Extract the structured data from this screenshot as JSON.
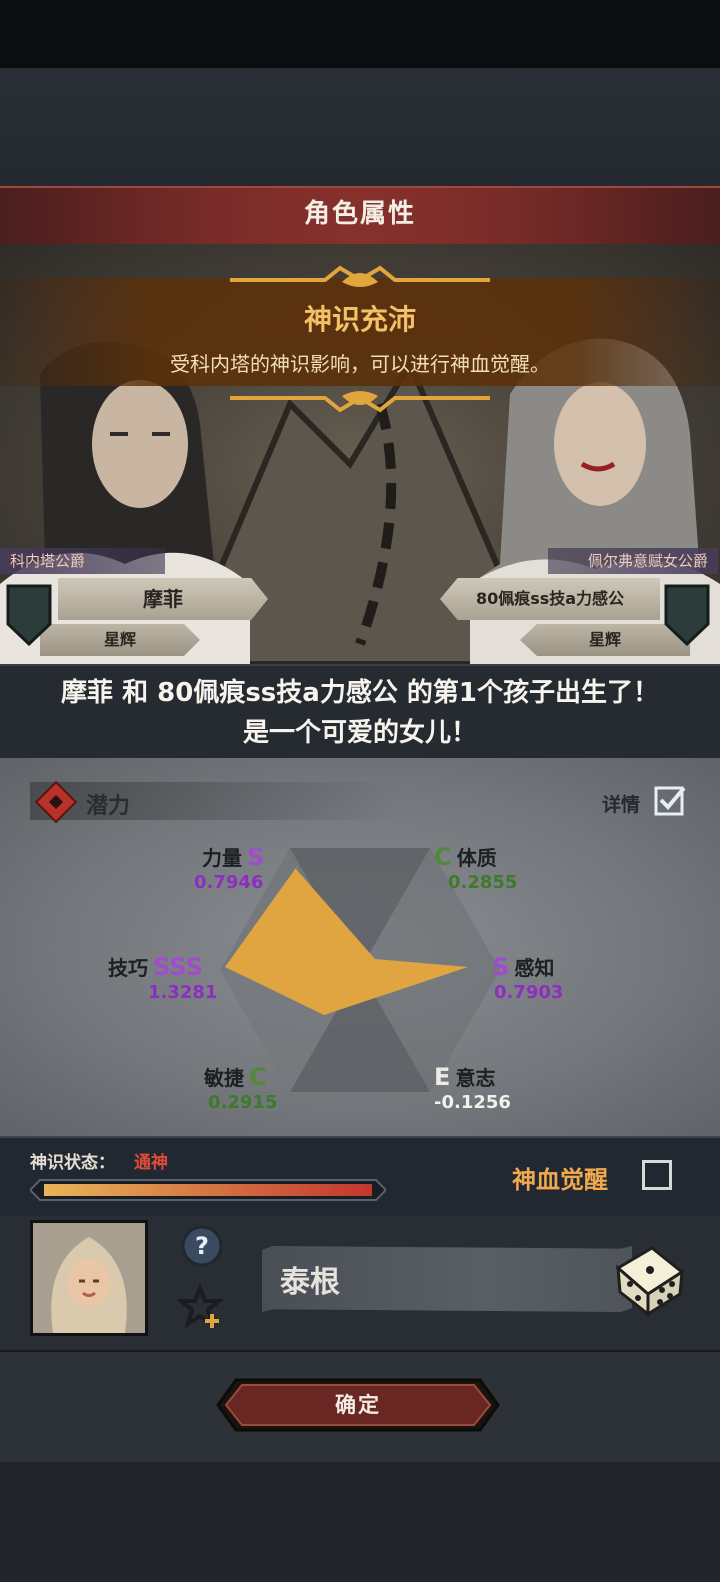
{
  "header": {
    "title": "角色属性"
  },
  "announcement": {
    "title": "神识充沛",
    "description": "受科内塔的神识影响，可以进行神血觉醒。"
  },
  "parents": {
    "father": {
      "title": "科内塔公爵",
      "name": "摩菲",
      "sub": "星辉"
    },
    "mother": {
      "title": "佩尔弗意赋女公爵",
      "name": "80佩痕ss技a力感公",
      "sub": "星辉"
    }
  },
  "birth_message": {
    "line1": "摩菲 和 80佩痕ss技a力感公 的第1个孩子出生了！",
    "line2": "是一个可爱的女儿！"
  },
  "potential": {
    "label": "潜力",
    "detail_label": "详情",
    "detail_checked": true,
    "stats": {
      "strength": {
        "name": "力量",
        "grade": "S",
        "value": "0.7946"
      },
      "constitution": {
        "name": "体质",
        "grade": "C",
        "value": "0.2855"
      },
      "skill": {
        "name": "技巧",
        "grade": "SSS",
        "value": "1.3281"
      },
      "perception": {
        "name": "感知",
        "grade": "S",
        "value": "0.7903"
      },
      "agility": {
        "name": "敏捷",
        "grade": "C",
        "value": "0.2915"
      },
      "will": {
        "name": "意志",
        "grade": "E",
        "value": "-0.1256"
      }
    },
    "radar_color": "#e0a540"
  },
  "bloodline": {
    "state_label": "神识状态：",
    "state_value": "通神",
    "progress": 1.0,
    "awaken_label": "神血觉醒",
    "awaken_checked": false
  },
  "child": {
    "name_value": "泰根",
    "icons": {
      "help": "question-icon",
      "star": "star-add-icon",
      "dice": "dice-icon"
    }
  },
  "confirm": {
    "label": "确定"
  }
}
